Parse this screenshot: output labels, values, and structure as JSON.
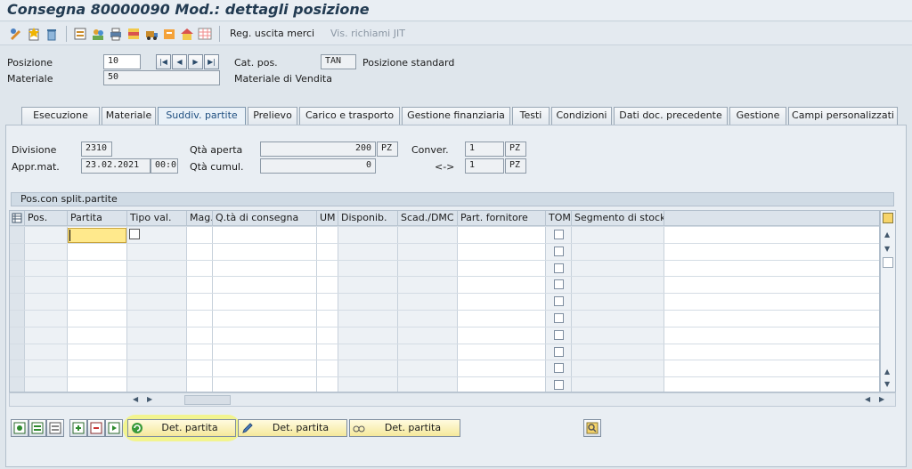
{
  "window": {
    "title": "Consegna 80000090 Mod.: dettagli posizione"
  },
  "toolbar": {
    "goods_issue_label": "Reg. uscita merci",
    "jit_calls_label": "Vis. richiami JIT"
  },
  "header": {
    "position_label": "Posizione",
    "position_value": "10",
    "material_label": "Materiale",
    "material_value": "50",
    "item_category_label": "Cat. pos.",
    "item_category_value": "TAN",
    "item_category_text": "Posizione standard",
    "material_text": "Materiale di Vendita"
  },
  "tabs": [
    {
      "label": "Esecuzione"
    },
    {
      "label": "Materiale"
    },
    {
      "label": "Suddiv. partite"
    },
    {
      "label": "Prelievo"
    },
    {
      "label": "Carico e trasporto"
    },
    {
      "label": "Gestione finanziaria"
    },
    {
      "label": "Testi"
    },
    {
      "label": "Condizioni"
    },
    {
      "label": "Dati doc. precedente"
    },
    {
      "label": "Gestione"
    },
    {
      "label": "Campi personalizzati"
    }
  ],
  "active_tab": "Suddiv. partite",
  "batch": {
    "plant_label": "Divisione",
    "plant_value": "2310",
    "approval_label": "Appr.mat.",
    "approval_date": "23.02.2021",
    "approval_time": "00:0...",
    "open_qty_label": "Qtà aperta",
    "open_qty_value": "200",
    "open_qty_uom": "PZ",
    "cum_qty_label": "Qtà cumul.",
    "cum_qty_value": "0",
    "conv_label": "Conver.",
    "conv_value1": "1",
    "conv_uom1": "PZ",
    "conv_arrow": "<->",
    "conv_value2": "1",
    "conv_uom2": "PZ"
  },
  "grid": {
    "title": "Pos.con split.partite",
    "columns": [
      "Pos.",
      "Partita",
      "Tipo val.",
      "Mag.",
      "Q.tà di consegna",
      "UM",
      "Disponib.",
      "Scad./DMC",
      "Part. fornitore",
      "TOM",
      "Segmento di stock"
    ],
    "row_count": 10
  },
  "buttons": {
    "det_partita_1": "Det. partita",
    "det_partita_2": "Det. partita",
    "det_partita_3": "Det. partita"
  }
}
